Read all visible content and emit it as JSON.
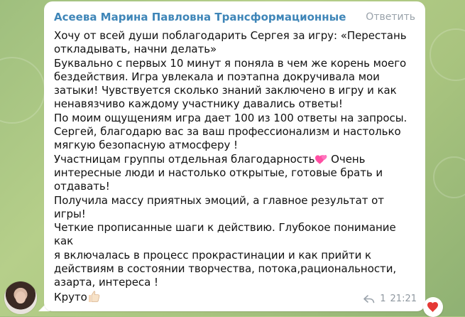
{
  "message": {
    "author": "Асеева Марина Павловна Трансформационные Иг...",
    "reply_label": "Ответить",
    "text_lines": [
      "Хочу от всей души поблагодарить Сергея за игру: «Перестань",
      "откладывать, начни делать»",
      "Буквально с первых 10 минут я поняла в чем же корень моего",
      "бездействия. Игра увлекала и поэтапна докручивала мои",
      "затыки! Чувствуется сколько знаний заключено в игру и как",
      "ненавязчиво каждому участнику давались ответы!",
      "По моим ощущениям игра дает 100 из 100 ответы на запросы.",
      "Сергей, благодарю вас за ваш профессионализм и настолько",
      "мягкую безопасную атмосферу !",
      "Участницам группы отдельная благодарность",
      " Очень",
      "интересные люди и настолько открытые, готовые брать и",
      "отдавать!",
      "Получила массу приятных эмоций, а главное результат от игры!",
      "Четкие прописанные шаги к действию. Глубокое понимание как",
      "я включалась в процесс прокрастинации и как прийти к",
      "действиям в состоянии творчества, потока,рациональности,",
      "азарта, интереса !",
      "Круто"
    ],
    "reply_count": "1",
    "time": "21:21",
    "reaction_icon": "red-heart-icon",
    "colors": {
      "author": "#3f86b8",
      "meta": "#8f98a0",
      "heart": "#e53935"
    }
  }
}
